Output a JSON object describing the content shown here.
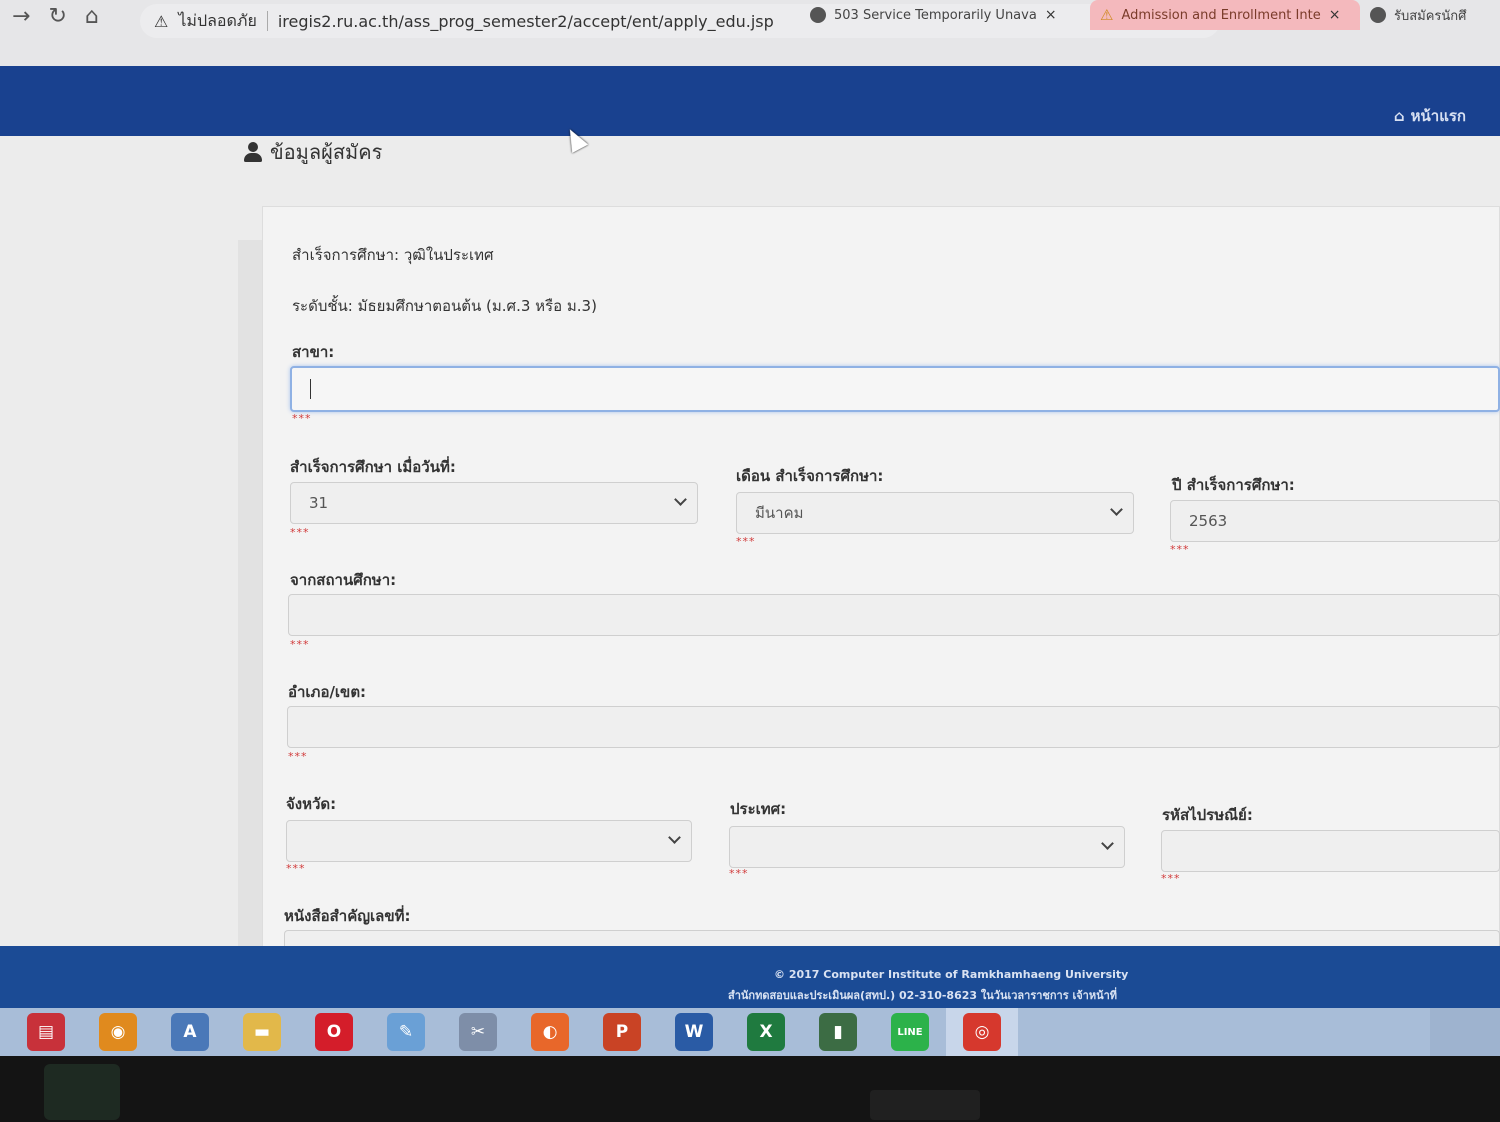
{
  "browser": {
    "tabs": [
      {
        "title": "503 Service Temporarily Unava",
        "close": "×"
      },
      {
        "title": "Admission and Enrollment Inte",
        "close": "×"
      },
      {
        "title": "รับสมัครนักศึ"
      }
    ],
    "security_label": "ไม่ปลอดภัย",
    "url": "iregis2.ru.ac.th/ass_prog_semester2/accept/ent/apply_edu.jsp"
  },
  "header": {
    "home_label": "หน้าแรก",
    "home_icon": "home-icon"
  },
  "page": {
    "title": "ข้อมูลผู้สมัคร",
    "title_icon": "user-icon"
  },
  "form": {
    "graduated_type": "สำเร็จการศึกษา: วุฒิในประเทศ",
    "level": "ระดับชั้น: มัธยมศึกษาตอนต้น (ม.ศ.3 หรือ ม.3)",
    "branch": {
      "label": "สาขา:",
      "value": ""
    },
    "grad_day": {
      "label": "สำเร็จการศึกษา เมื่อวันที่:",
      "value": "31"
    },
    "grad_month": {
      "label": "เดือน สำเร็จการศึกษา:",
      "value": "มีนาคม"
    },
    "grad_year": {
      "label": "ปี สำเร็จการศึกษา:",
      "value": "2563"
    },
    "school": {
      "label": "จากสถานศึกษา:",
      "value": ""
    },
    "district": {
      "label": "อำเภอ/เขต:",
      "value": ""
    },
    "province": {
      "label": "จังหวัด:",
      "value": ""
    },
    "country": {
      "label": "ประเทศ:",
      "value": ""
    },
    "postcode": {
      "label": "รหัสไปรษณีย์:",
      "value": ""
    },
    "doc_no": {
      "label": "หนังสือสำคัญเลขที่:"
    },
    "required_mark": "***"
  },
  "footer": {
    "line1": "© 2017 Computer Institute of Ramkhamhaeng University",
    "line2": "สำนักทดสอบและประเมินผล(สทป.) 02-310-8623 ในวันเวลาราชการ เจ้าหน้าที่"
  },
  "taskbar": {
    "apps": [
      {
        "name": "news-app",
        "color": "#c8313a",
        "glyph": "▤"
      },
      {
        "name": "avast",
        "color": "#e08a1e",
        "glyph": "◉"
      },
      {
        "name": "editor",
        "color": "#4a78b8",
        "glyph": "A"
      },
      {
        "name": "file-explorer",
        "color": "#e2b84a",
        "glyph": "▬"
      },
      {
        "name": "opera",
        "color": "#d41d2a",
        "glyph": "O"
      },
      {
        "name": "paint",
        "color": "#6aa0d6",
        "glyph": "✎"
      },
      {
        "name": "snipping",
        "color": "#7e8ea8",
        "glyph": "✂"
      },
      {
        "name": "firefox",
        "color": "#e8672a",
        "glyph": "◐"
      },
      {
        "name": "powerpoint",
        "color": "#c94325",
        "glyph": "P"
      },
      {
        "name": "word",
        "color": "#2a5ba5",
        "glyph": "W"
      },
      {
        "name": "excel",
        "color": "#1f7a3f",
        "glyph": "X"
      },
      {
        "name": "reader",
        "color": "#3c6c44",
        "glyph": "▮"
      },
      {
        "name": "line",
        "color": "#2cb24a",
        "glyph": "LINE"
      },
      {
        "name": "chrome",
        "color": "#d6382d",
        "glyph": "◎"
      }
    ]
  }
}
